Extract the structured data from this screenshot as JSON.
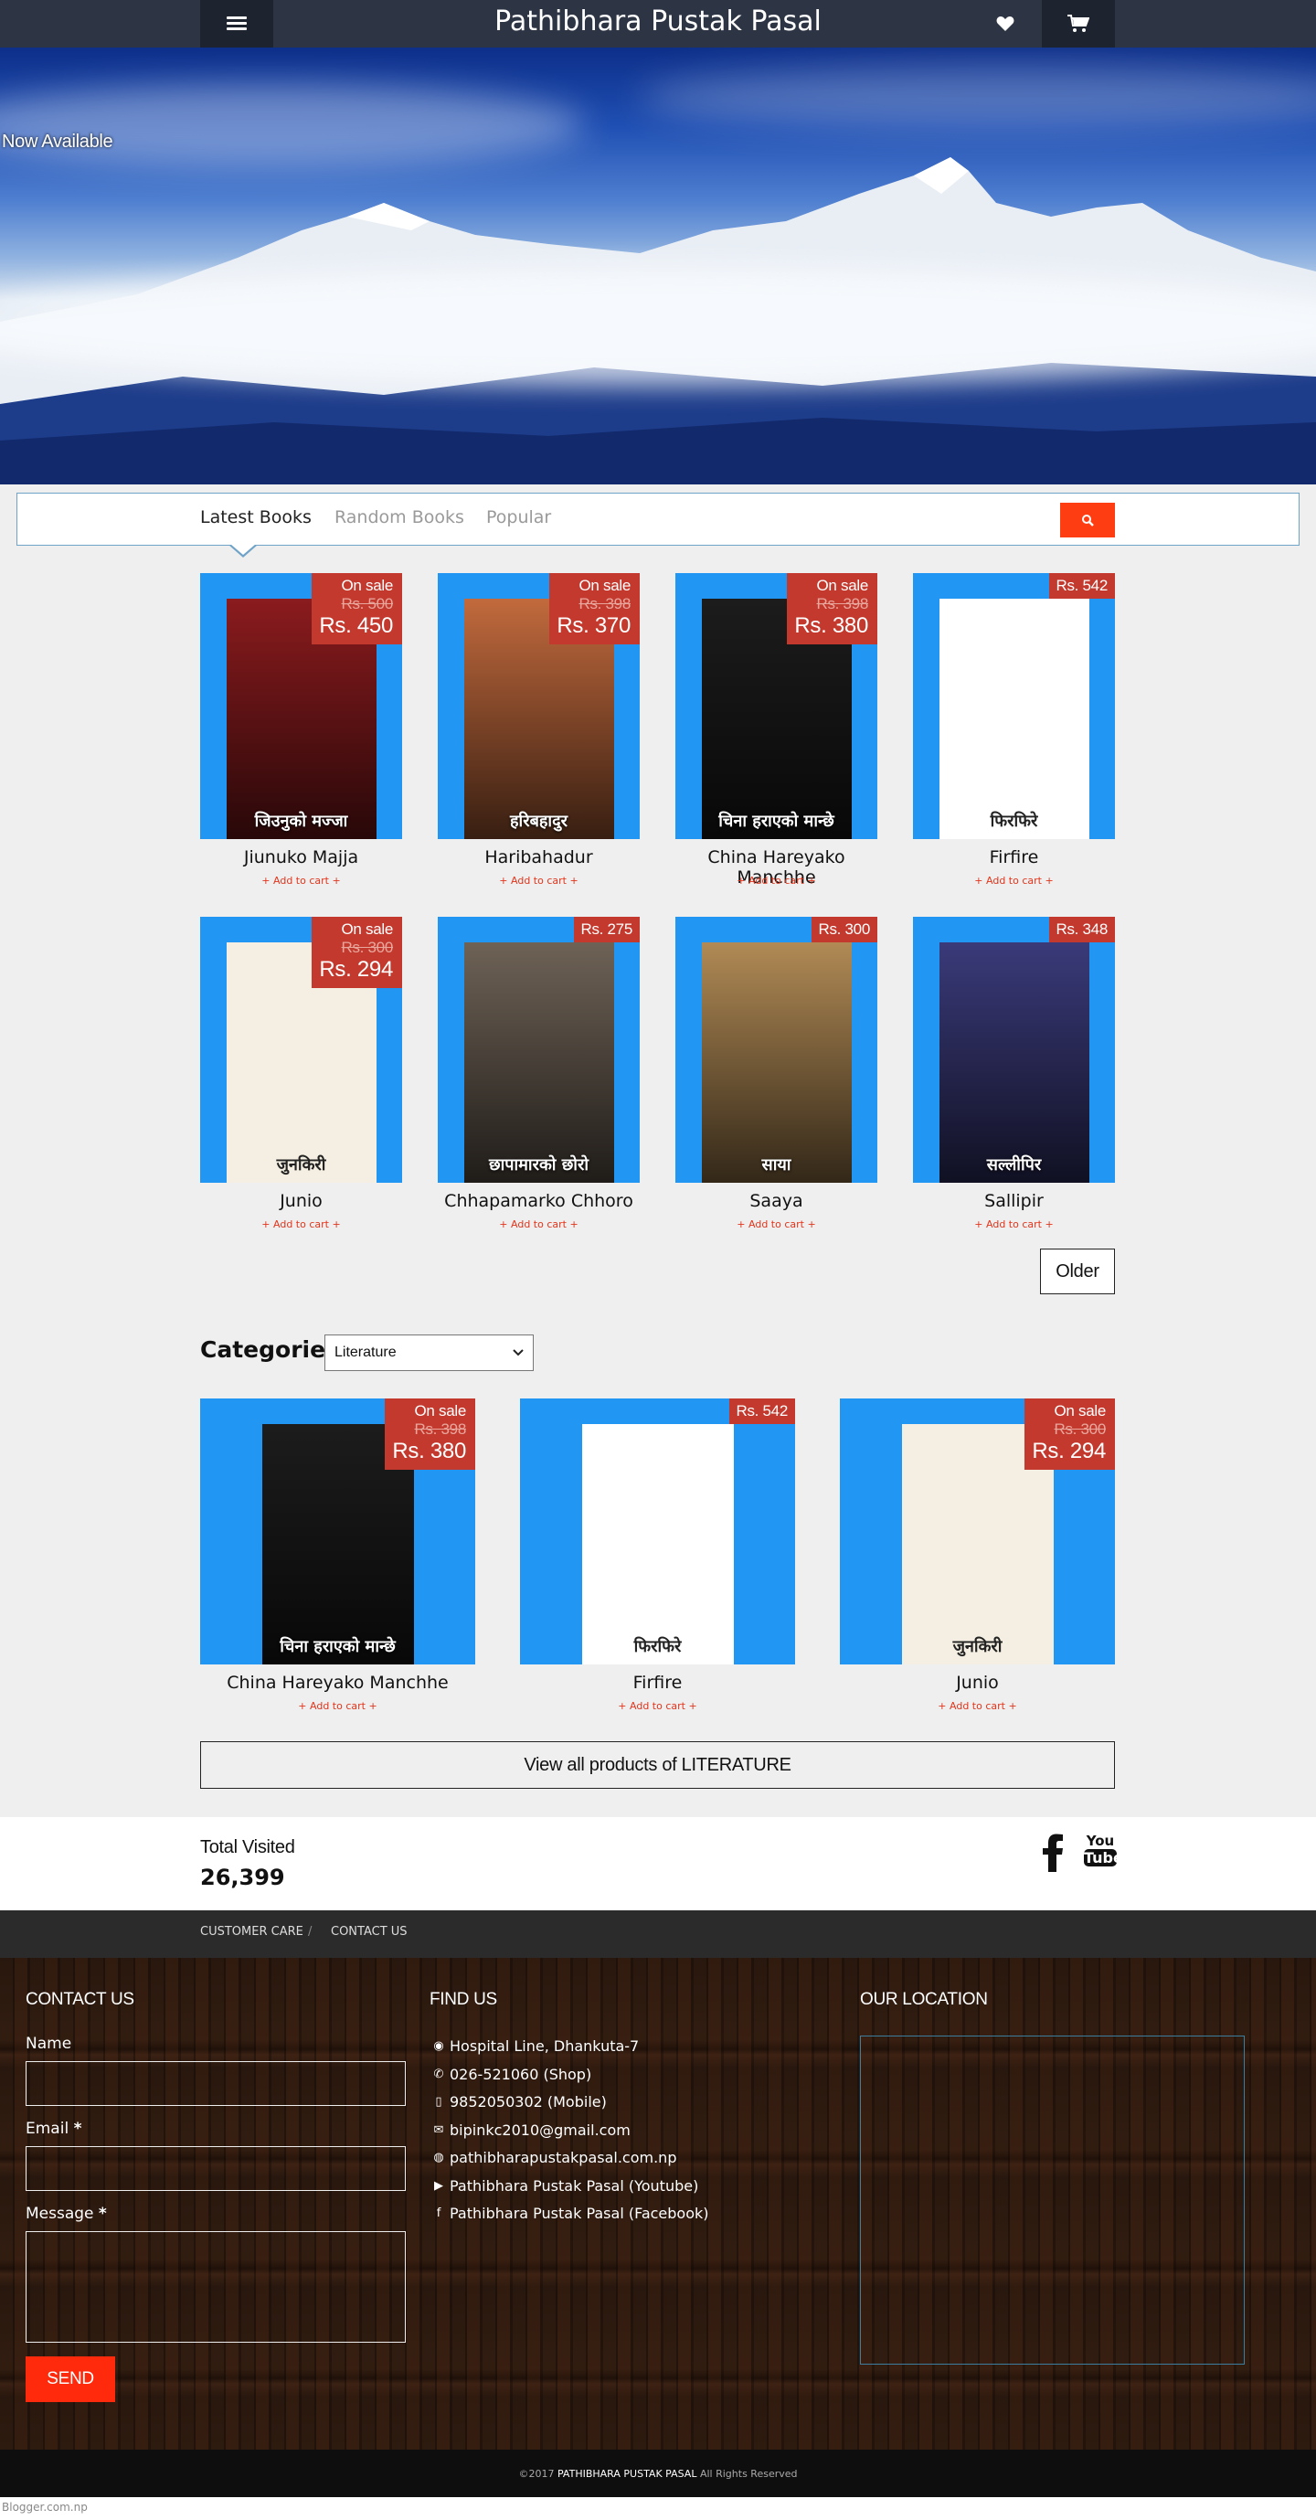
{
  "header": {
    "title": "Pathibhara Pustak Pasal"
  },
  "hero": {
    "caption": "Now Available"
  },
  "tabs": [
    {
      "label": "Latest Books"
    },
    {
      "label": "Random Books"
    },
    {
      "label": "Popular"
    }
  ],
  "latest_books": [
    {
      "title": "Jiunuko Majja",
      "on_sale": "On sale",
      "old_price": "Rs. 500",
      "price": "Rs. 450",
      "add": "+ Add to cart +",
      "cover_text": "जिउनुको मज्जा",
      "cover_color": "#8b1b1e"
    },
    {
      "title": "Haribahadur",
      "on_sale": "On sale",
      "old_price": "Rs. 398",
      "price": "Rs. 370",
      "add": "+ Add to cart +",
      "cover_text": "हरिबहादुर",
      "cover_color": "#c26a3d"
    },
    {
      "title": "China Hareyako Manchhe",
      "on_sale": "On sale",
      "old_price": "Rs. 398",
      "price": "Rs. 380",
      "add": "+ Add to cart +",
      "cover_text": "चिना हराएको मान्छे",
      "cover_color": "#1c1c1c"
    },
    {
      "title": "Firfire",
      "price": "Rs. 542",
      "add": "+ Add to cart +",
      "cover_text": "फिरफिरे",
      "cover_color": "#ffffff"
    },
    {
      "title": "Junio",
      "on_sale": "On sale",
      "old_price": "Rs. 300",
      "price": "Rs. 294",
      "add": "+ Add to cart +",
      "cover_text": "जुनकिरी",
      "cover_color": "#f4efe2"
    },
    {
      "title": "Chhapamarko Chhoro",
      "price": "Rs. 275",
      "add": "+ Add to cart +",
      "cover_text": "छापामारको छोरो",
      "cover_color": "#6e6256"
    },
    {
      "title": "Saaya",
      "price": "Rs. 300",
      "add": "+ Add to cart +",
      "cover_text": "साया",
      "cover_color": "#b18a55"
    },
    {
      "title": "Sallipir",
      "price": "Rs. 348",
      "add": "+ Add to cart +",
      "cover_text": "सल्लीपिर",
      "cover_color": "#3a3a7a"
    }
  ],
  "older_label": "Older",
  "categories": {
    "title": "Categories",
    "selected": "Literature",
    "items": [
      {
        "title": "China Hareyako Manchhe",
        "on_sale": "On sale",
        "old_price": "Rs. 398",
        "price": "Rs. 380",
        "add": "+ Add to cart +",
        "cover_text": "चिना हराएको मान्छे",
        "cover_color": "#1c1c1c"
      },
      {
        "title": "Firfire",
        "price": "Rs. 542",
        "add": "+ Add to cart +",
        "cover_text": "फिरफिरे",
        "cover_color": "#ffffff"
      },
      {
        "title": "Junio",
        "on_sale": "On sale",
        "old_price": "Rs. 300",
        "price": "Rs. 294",
        "add": "+ Add to cart +",
        "cover_text": "जुनकिरी",
        "cover_color": "#f4efe2"
      }
    ],
    "view_all": "View all products of LITERATURE"
  },
  "stats": {
    "label": "Total Visited",
    "value": "26,399",
    "youtube_top": "You",
    "youtube_bottom": "Tube"
  },
  "footer_nav": [
    {
      "label": "CUSTOMER CARE"
    },
    {
      "label": "CONTACT US"
    }
  ],
  "contact": {
    "heading": "CONTACT US",
    "name_label": "Name",
    "email_label": "Email",
    "message_label": "Message",
    "required_mark": "*",
    "send": "SEND"
  },
  "find_us": {
    "heading": "FIND US",
    "lines": [
      {
        "icon": "map-marker-icon",
        "text": "Hospital Line, Dhankuta-7"
      },
      {
        "icon": "phone-icon",
        "text": "026-521060 (Shop)"
      },
      {
        "icon": "mobile-icon",
        "text": "9852050302 (Mobile)"
      },
      {
        "icon": "envelope-icon",
        "text": "bipinkc2010@gmail.com"
      },
      {
        "icon": "globe-icon",
        "text": "pathibharapustakpasal.com.np"
      },
      {
        "icon": "youtube-icon",
        "text": "Pathibhara Pustak Pasal (Youtube)"
      },
      {
        "icon": "facebook-icon",
        "text": "Pathibhara Pustak Pasal (Facebook)"
      }
    ]
  },
  "location": {
    "heading": "OUR LOCATION"
  },
  "copyright": {
    "prefix": "©2017",
    "name": "PATHIBHARA PUSTAK PASAL",
    "suffix": "All Rights Reserved"
  },
  "bottom_text": "Blogger.com.np",
  "colors": {
    "accent": "#ff3d12",
    "card_blue": "#2196f3",
    "badge": "#c3392e",
    "header": "#2d3444"
  }
}
